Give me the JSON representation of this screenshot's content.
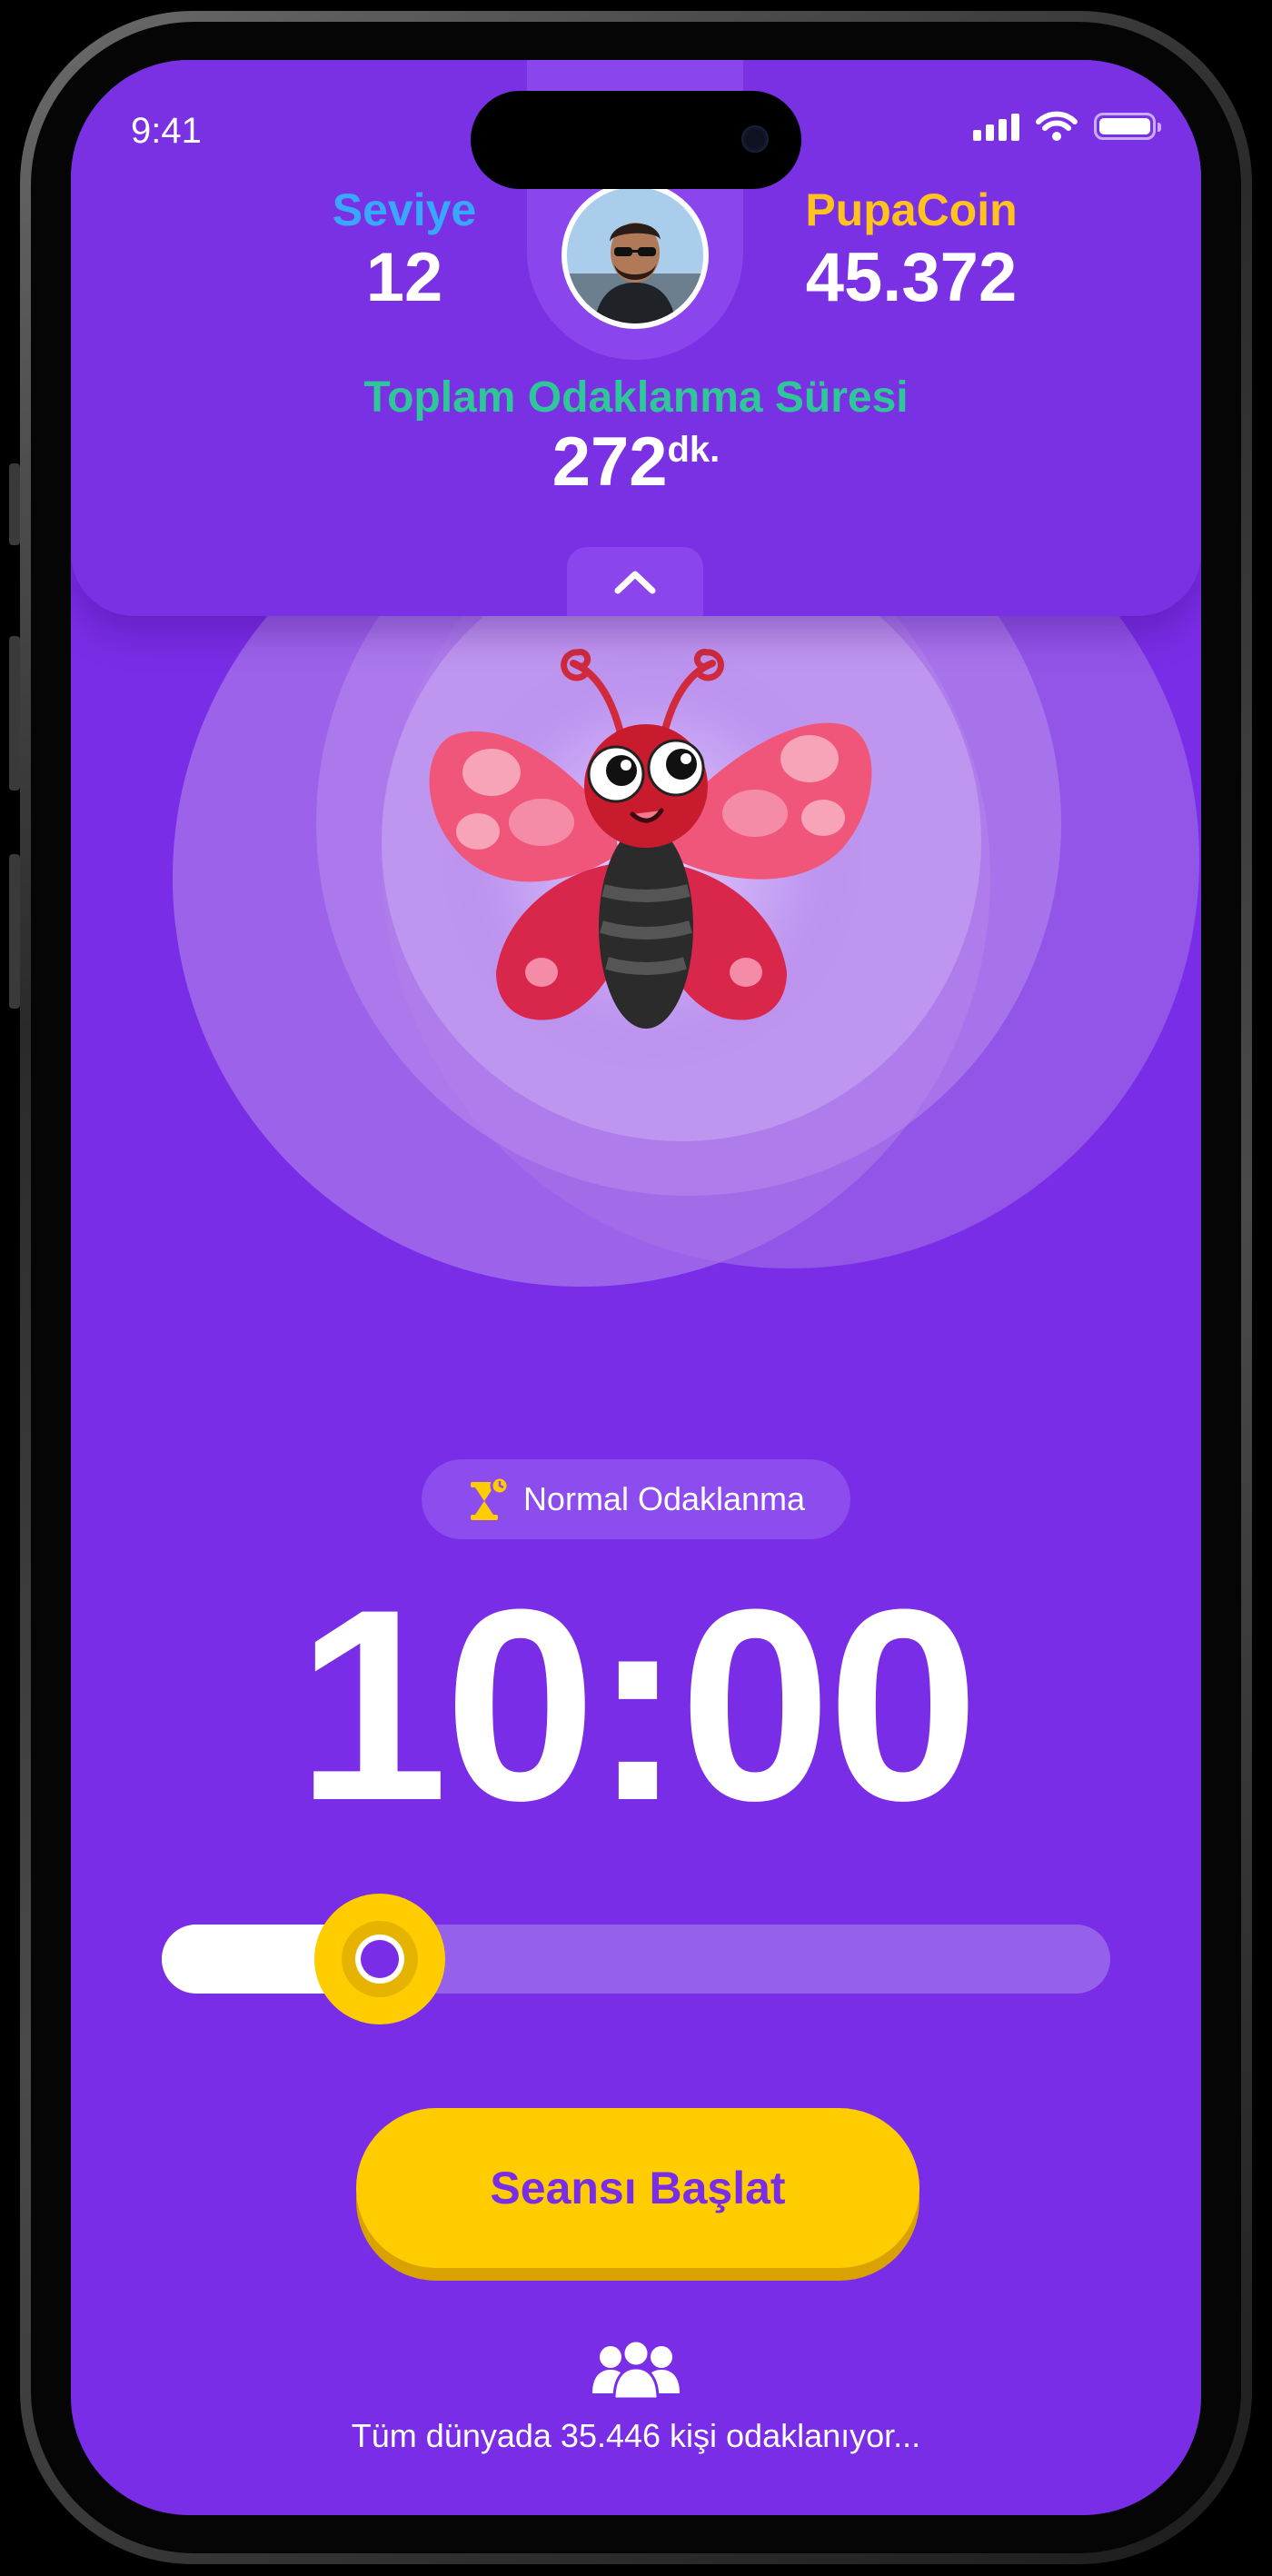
{
  "status_bar": {
    "time": "9:41"
  },
  "header": {
    "level": {
      "label": "Seviye",
      "value": "12",
      "color": "#3aa7ff"
    },
    "coins": {
      "label": "PupaCoin",
      "value": "45.372",
      "color": "#ffc21f"
    },
    "focus_total": {
      "label": "Toplam Odaklanma Süresi",
      "value": "272",
      "unit": "dk.",
      "color": "#2fc79a"
    },
    "collapse_icon": "chevron-up-icon",
    "avatar_icon": "user-avatar"
  },
  "mascot": {
    "icon": "butterfly-mascot"
  },
  "session": {
    "mode_label": "Normal Odaklanma",
    "mode_icon": "hourglass-icon",
    "timer": "10:00",
    "slider_fraction": 0.23
  },
  "start_button_label": "Seansı Başlat",
  "footer": {
    "icon": "people-icon",
    "text": "Tüm dünyada 35.446 kişi odaklanıyor..."
  },
  "colors": {
    "background": "#7a2de6",
    "accent": "#ffcc00",
    "button_text": "#7a2de6"
  }
}
